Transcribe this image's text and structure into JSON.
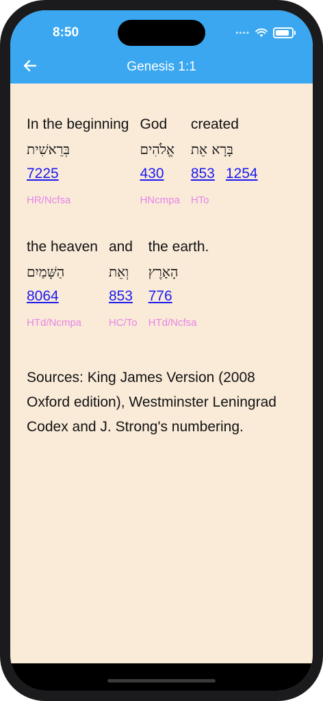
{
  "status": {
    "time": "8:50",
    "battery_level": 0.85
  },
  "header": {
    "title": "Genesis 1:1"
  },
  "verse": {
    "rows": [
      [
        {
          "english": "In the beginning",
          "hebrew": "בְּרֵאשִׁית",
          "numbers": [
            "7225"
          ],
          "morph": "HR/Ncfsa"
        },
        {
          "english": "God",
          "hebrew": "אֱלֹהִים",
          "numbers": [
            "430"
          ],
          "morph": "HNcmpa"
        },
        {
          "english": "created",
          "hebrew": "בָּרָא אֵת",
          "numbers": [
            "853",
            "1254"
          ],
          "morph": "HTo"
        }
      ],
      [
        {
          "english": "the heaven",
          "hebrew": "הַשָּׁמַיִם",
          "numbers": [
            "8064"
          ],
          "morph": "HTd/Ncmpa"
        },
        {
          "english": "and",
          "hebrew": "וְאֵת",
          "numbers": [
            "853"
          ],
          "morph": "HC/To"
        },
        {
          "english": "the earth.",
          "hebrew": "הָאָרֶץ",
          "numbers": [
            "776"
          ],
          "morph": "HTd/Ncfsa"
        }
      ]
    ]
  },
  "sources": "Sources: King James Version (2008 Oxford edition), Westminster Leningrad Codex and J. Strong's numbering.",
  "colors": {
    "header": "#3aa7f0",
    "background": "#faebd9",
    "link": "#1a1aee",
    "morph": "#e884e6"
  },
  "icons": {
    "back": "arrow-left-icon",
    "wifi": "wifi-icon",
    "battery": "battery-icon"
  }
}
